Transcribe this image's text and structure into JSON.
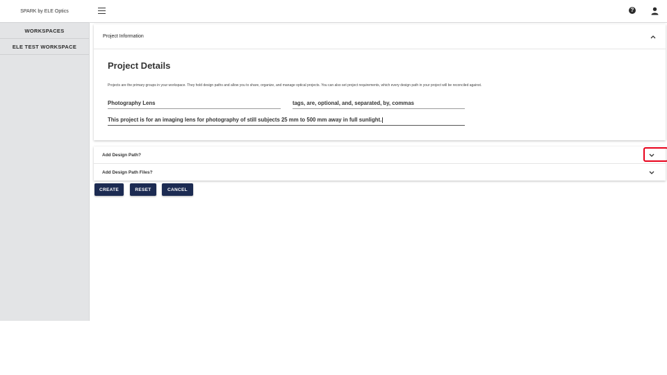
{
  "sidebar": {
    "brand": "SPARK by ELE Optics",
    "items": [
      {
        "label": "WORKSPACES"
      },
      {
        "label": "ELE TEST WORKSPACE"
      }
    ]
  },
  "topbar": {
    "menu_icon": "hamburger-menu-icon",
    "help_icon": "help-circle-icon",
    "help_glyph": "?",
    "user_icon": "user-icon"
  },
  "project_info": {
    "header": "Project Information",
    "title": "Project Details",
    "description": "Projects are the primary groups in your workspace. They hold design paths and allow you to share, organize, and manage optical projects. You can also set project requirements, which every design path in your project will be reconciled against.",
    "name_value": "Photography Lens",
    "tags_value": "tags, are, optional, and, separated, by, commas",
    "description_value": "This project is for an imaging lens for photography of still subjects 25 mm to 500 mm away in full sunlight."
  },
  "accordions": [
    {
      "label": "Add Design Path?"
    },
    {
      "label": "Add Design Path Files?"
    }
  ],
  "actions": {
    "create": "CREATE",
    "reset": "RESET",
    "cancel": "CANCEL"
  },
  "colors": {
    "button_bg": "#1c2b52",
    "sidebar_bg": "#e3e4e6",
    "highlight": "#e8001a"
  }
}
